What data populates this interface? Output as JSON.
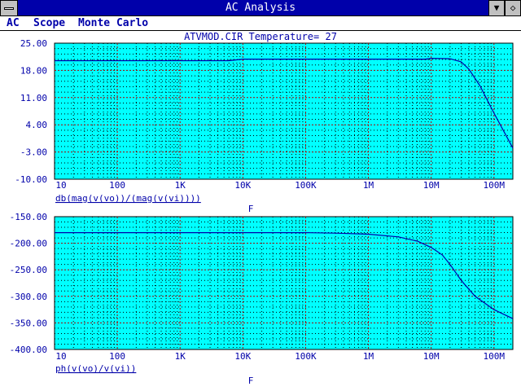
{
  "window": {
    "title": "AC Analysis",
    "icons": [
      "system-menu-icon",
      "minimize-arrow-icon",
      "restore-icon"
    ]
  },
  "menu": {
    "items": [
      "AC",
      "Scope",
      "Monte Carlo"
    ]
  },
  "plot_header": "ATVMOD.CIR Temperature= 27",
  "colors": {
    "plot_background": "#00ffff",
    "grid_major": "#aa0000",
    "grid_minor": "#000000",
    "trace": "#0000aa",
    "text": "#0000aa",
    "titlebar": "#0000aa"
  },
  "chart_data": [
    {
      "type": "line",
      "title": "",
      "xscale": "log",
      "xlabel": "F",
      "trace_label": "db(mag(v(vo))/(mag(v(vi))))",
      "xlim": [
        10,
        200000000
      ],
      "ylim": [
        -10,
        25
      ],
      "x_ticks": [
        "10",
        "100",
        "1K",
        "10K",
        "100K",
        "1M",
        "10M",
        "100M"
      ],
      "y_ticks": [
        "25.00",
        "18.00",
        "11.00",
        "4.00",
        "-3.00",
        "-10.00"
      ],
      "y_tick_values": [
        25,
        18,
        11,
        4,
        -3,
        -10
      ],
      "grid": true,
      "series": [
        {
          "x": [
            10,
            100,
            1000,
            6000,
            10000,
            100000,
            1000000,
            8000000,
            10000000,
            20000000,
            30000000,
            40000000,
            60000000,
            100000000,
            200000000
          ],
          "y": [
            20.5,
            20.5,
            20.5,
            20.5,
            20.9,
            20.9,
            20.9,
            20.9,
            21.1,
            21.0,
            20.2,
            18.3,
            14.0,
            7.0,
            -2.0
          ]
        }
      ]
    },
    {
      "type": "line",
      "title": "",
      "xscale": "log",
      "xlabel": "F",
      "trace_label": "ph(v(vo)/v(vi))",
      "xlim": [
        10,
        200000000
      ],
      "ylim": [
        -400,
        -150
      ],
      "x_ticks": [
        "10",
        "100",
        "1K",
        "10K",
        "100K",
        "1M",
        "10M",
        "100M"
      ],
      "y_ticks": [
        "-150.00",
        "-200.00",
        "-250.00",
        "-300.00",
        "-350.00",
        "-400.00"
      ],
      "y_tick_values": [
        -150,
        -200,
        -250,
        -300,
        -350,
        -400
      ],
      "grid": true,
      "series": [
        {
          "x": [
            10,
            100,
            1000,
            10000,
            100000,
            300000,
            1000000,
            3000000,
            6000000,
            10000000,
            15000000,
            20000000,
            30000000,
            50000000,
            100000000,
            200000000
          ],
          "y": [
            -180,
            -180,
            -180,
            -180,
            -180,
            -181,
            -183,
            -188,
            -196,
            -208,
            -222,
            -240,
            -270,
            -300,
            -325,
            -342
          ]
        }
      ]
    }
  ]
}
